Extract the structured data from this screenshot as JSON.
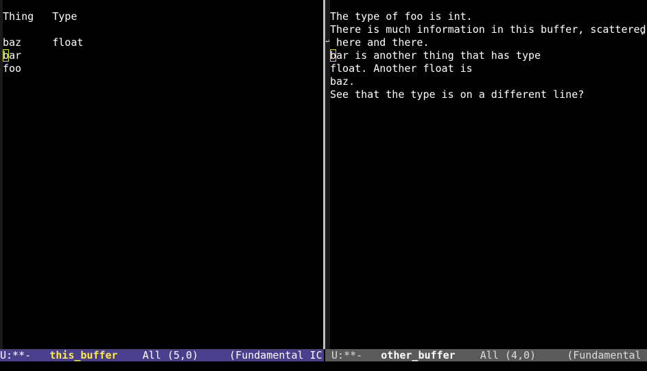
{
  "left_window": {
    "lines": [
      "Thing   Type",
      "",
      "baz     float",
      "bar",
      "foo"
    ],
    "cursor": {
      "line": 3,
      "col": 0
    }
  },
  "right_window": {
    "lines": [
      "The type of foo is int.",
      "There is much information in this buffer, scattered",
      " here and there.",
      "bar is another thing that has type",
      "float. Another float is",
      "baz.",
      "See that the type is on a different line?"
    ],
    "cursor": {
      "line": 3,
      "col": 0
    }
  },
  "modeline_left": {
    "status": "U:**-",
    "buffer_name": "this_buffer",
    "position": "All (5,0)",
    "mode": "(Fundamental IC"
  },
  "modeline_right": {
    "status": "U:**-",
    "buffer_name": "other_buffer",
    "position": "All (4,0)",
    "mode": "(Fundamental IC"
  },
  "colors": {
    "active_modeline_bg": "#4a3f8c",
    "inactive_modeline_bg": "#5a5a5a",
    "buffer_name_active": "#ffeb3b",
    "cursor": "#e6e600"
  }
}
